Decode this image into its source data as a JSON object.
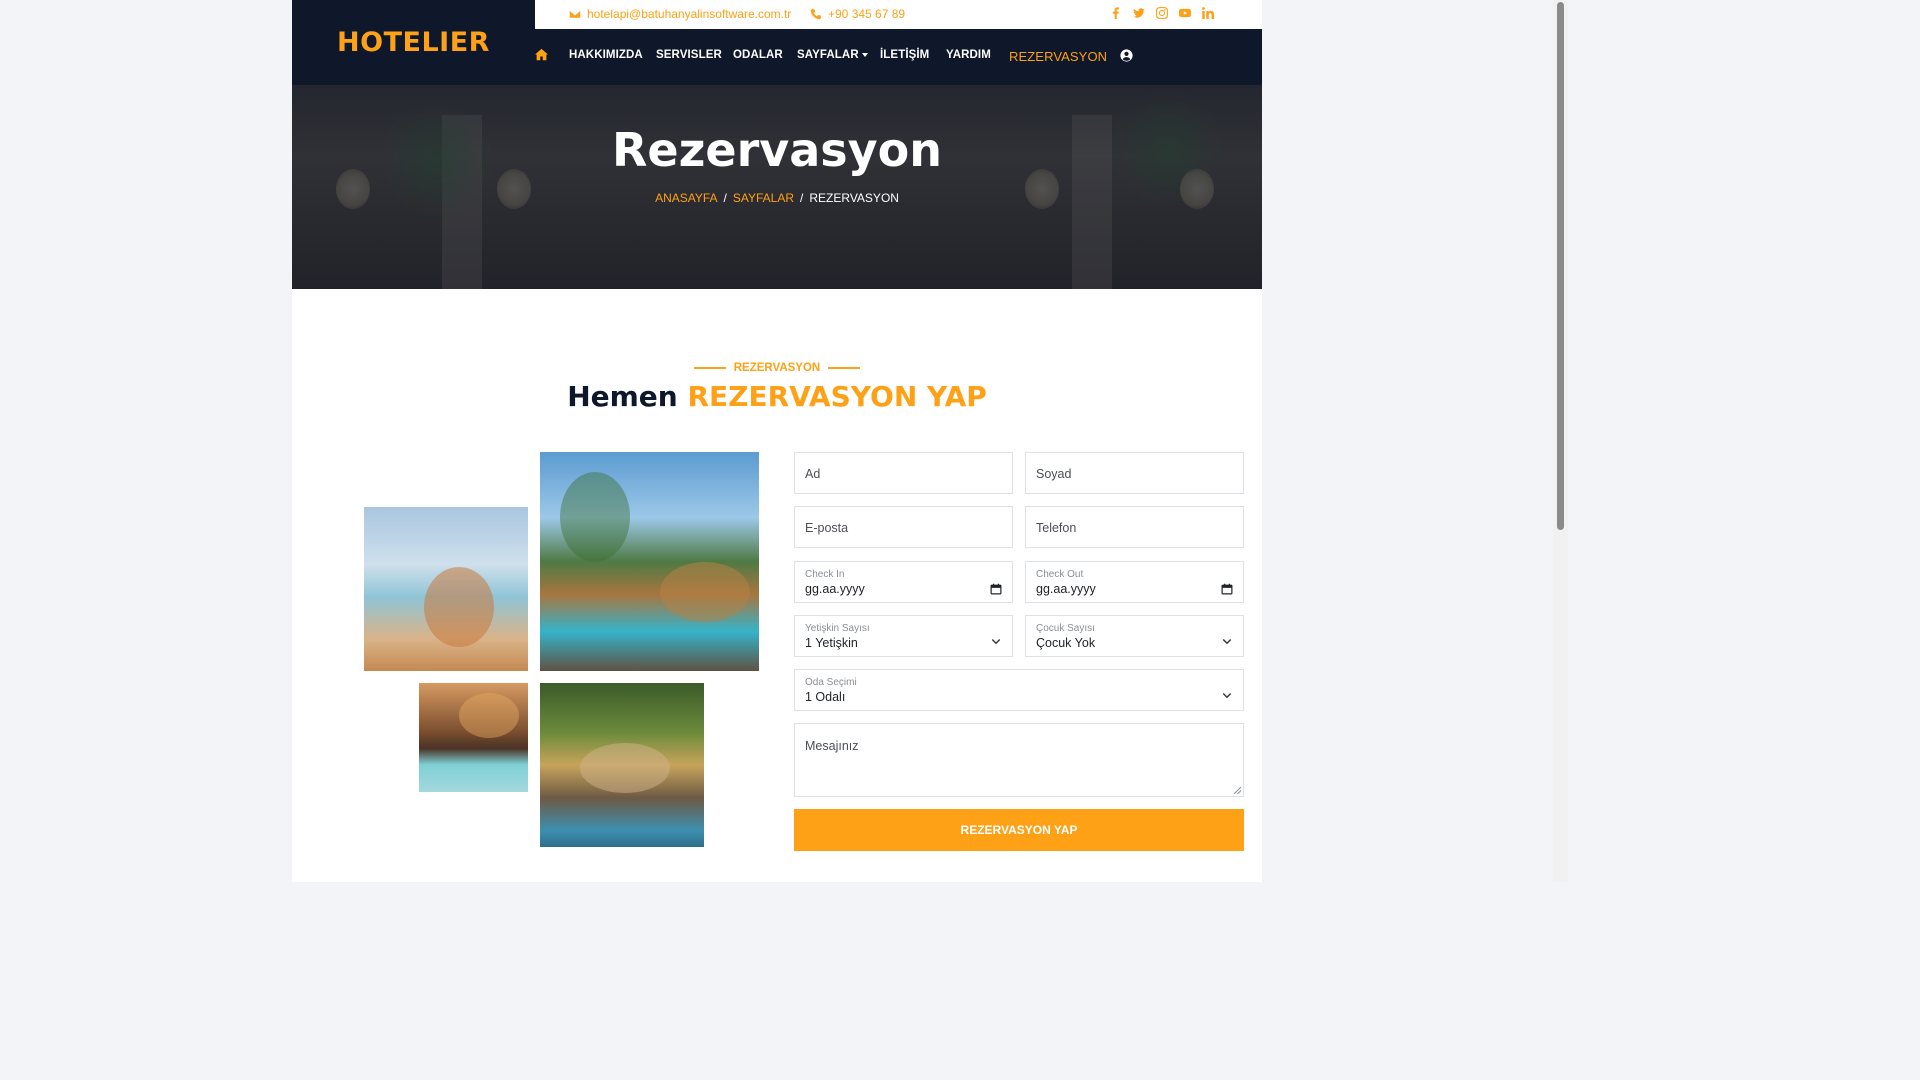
{
  "brand": {
    "name": "HOTELIER"
  },
  "topbar": {
    "email": "hotelapi@batuhanyalinsoftware.com.tr",
    "phone": "+90 345 67 89",
    "socials": [
      "facebook-icon",
      "twitter-icon",
      "instagram-icon",
      "youtube-icon",
      "linkedin-icon"
    ]
  },
  "nav": {
    "items": [
      "HAKKIMIZDA",
      "SERVISLER",
      "ODALAR",
      "SAYFALAR",
      "İLETİŞİM",
      "YARDIM",
      "REZERVASYON"
    ],
    "active": "REZERVASYON"
  },
  "hero": {
    "title": "Rezervasyon",
    "breadcrumb": [
      "ANASAYFA",
      "SAYFALAR",
      "REZERVASYON"
    ],
    "breadcrumb_sep": "/"
  },
  "section": {
    "label": "REZERVASYON",
    "title_main": "Hemen",
    "title_accent": "REZERVASYON YAP"
  },
  "form": {
    "first_name_placeholder": "Ad",
    "last_name_placeholder": "Soyad",
    "email_placeholder": "E-posta",
    "phone_placeholder": "Telefon",
    "checkin_label": "Check In",
    "checkin_value": "gg.aa.yyyy",
    "checkout_label": "Check Out",
    "checkout_value": "gg.aa.yyyy",
    "adults_label": "Yetişkin Sayısı",
    "adults_value": "1 Yetişkin",
    "children_label": "Çocuk Sayısı",
    "children_value": "Çocuk Yok",
    "room_label": "Oda Seçimi",
    "room_value": "1 Odalı",
    "message_placeholder": "Mesajınız",
    "submit_label": "REZERVASYON YAP"
  },
  "colors": {
    "accent": "#fea116",
    "dark": "#0f172b"
  }
}
